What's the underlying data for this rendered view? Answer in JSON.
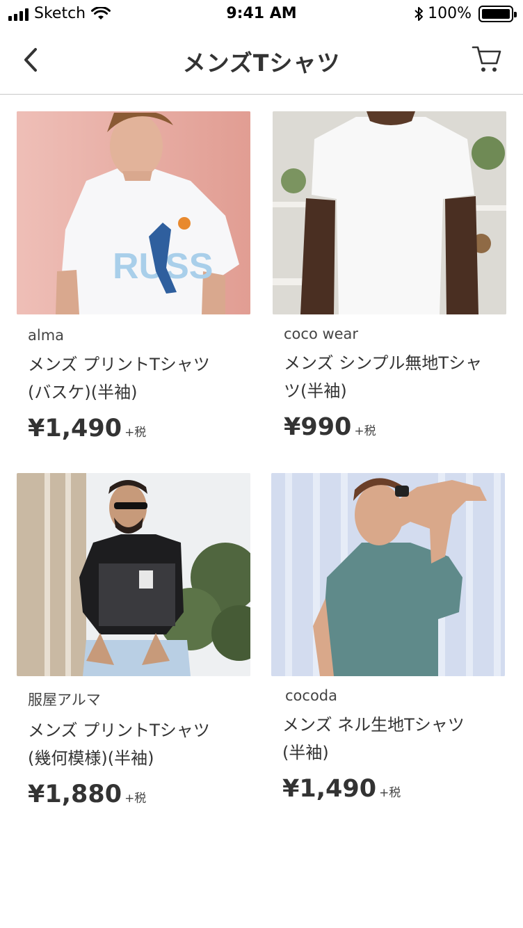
{
  "status_bar": {
    "carrier": "Sketch",
    "time": "9:41 AM",
    "battery": "100%"
  },
  "nav": {
    "title": "メンズTシャツ"
  },
  "products": [
    {
      "brand": "alma",
      "name_line1": "メンズ プリントTシャツ",
      "name_line2": "(バスケ)(半袖)",
      "price": "¥1,490",
      "tax": "+税"
    },
    {
      "brand": "coco wear",
      "name_line1": "メンズ シンプル無地Tシャ",
      "name_line2": "ツ(半袖)",
      "price": "¥990",
      "tax": "+税"
    },
    {
      "brand": "服屋アルマ",
      "name_line1": "メンズ プリントTシャツ",
      "name_line2": "(幾何模様)(半袖)",
      "price": "¥1,880",
      "tax": "+税"
    },
    {
      "brand": "cocoda",
      "name_line1": "メンズ ネル生地Tシャツ",
      "name_line2": "(半袖)",
      "price": "¥1,490",
      "tax": "+税"
    }
  ],
  "colors": {
    "text": "#333333",
    "divider": "#c8c8c8"
  }
}
